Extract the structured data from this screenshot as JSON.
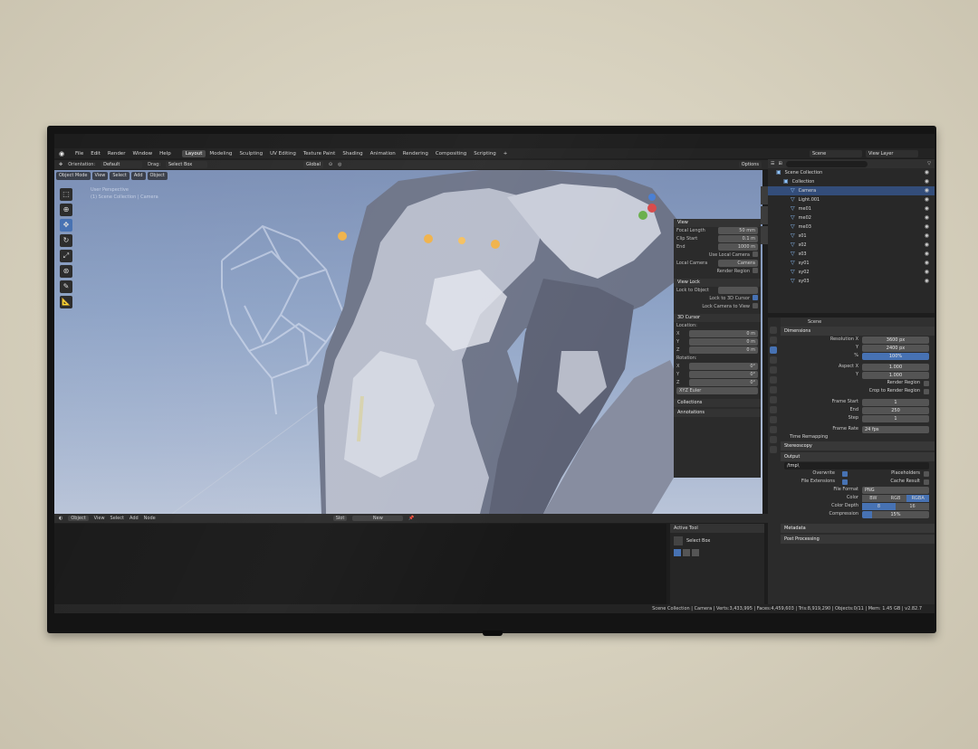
{
  "menu": {
    "items": [
      "File",
      "Edit",
      "Render",
      "Window",
      "Help"
    ],
    "workspaces": [
      "Layout",
      "Modeling",
      "Sculpting",
      "UV Editing",
      "Texture Paint",
      "Shading",
      "Animation",
      "Rendering",
      "Compositing",
      "Scripting"
    ],
    "add_tab": "+",
    "scene": "Scene",
    "view_layer": "View Layer"
  },
  "header": {
    "orientation_label": "Orientation:",
    "orientation_value": "Default",
    "drag_label": "Drag:",
    "drag_value": "Select Box",
    "transform_value": "Global",
    "options": "Options"
  },
  "viewport": {
    "mode": "Object Mode",
    "menu": [
      "View",
      "Select",
      "Add",
      "Object"
    ],
    "info_line1": "User Perspective",
    "info_line2": "(1) Scene Collection | Camera"
  },
  "npanel": {
    "view_header": "View",
    "focal_length_label": "Focal Length",
    "focal_length": "50 mm",
    "clip_start_label": "Clip Start",
    "clip_start": "0.1 m",
    "clip_end_label": "End",
    "clip_end": "1000 m",
    "use_local_camera": "Use Local Camera",
    "local_camera_label": "Local Camera",
    "local_camera_value": "Camera",
    "render_region": "Render Region",
    "view_lock_header": "View Lock",
    "lock_to_object": "Lock to Object",
    "lock_to_3d_cursor": "Lock to 3D Cursor",
    "lock_camera_to_view": "Lock Camera to View",
    "cursor_header": "3D Cursor",
    "location_label": "Location:",
    "x_label": "X",
    "y_label": "Y",
    "z_label": "Z",
    "loc_x": "0 m",
    "loc_y": "0 m",
    "loc_z": "0 m",
    "rotation_label": "Rotation:",
    "rot_x": "0°",
    "rot_y": "0°",
    "rot_z": "0°",
    "rotation_mode": "XYZ Euler",
    "collections": "Collections",
    "annotations": "Annotations"
  },
  "timeline": {
    "editor": "Object",
    "menu": [
      "View",
      "Select",
      "Add",
      "Node"
    ],
    "slot": "Slot",
    "new": "New"
  },
  "active_tool": {
    "header": "Active Tool",
    "tool": "Select Box"
  },
  "outliner": {
    "search_placeholder": "",
    "items": [
      {
        "label": "Scene Collection",
        "indent": 0
      },
      {
        "label": "Collection",
        "indent": 1
      },
      {
        "label": "Camera",
        "indent": 2
      },
      {
        "label": "Light.001",
        "indent": 2
      },
      {
        "label": "me01",
        "indent": 2
      },
      {
        "label": "me02",
        "indent": 2
      },
      {
        "label": "me03",
        "indent": 2
      },
      {
        "label": "s01",
        "indent": 2
      },
      {
        "label": "s02",
        "indent": 2
      },
      {
        "label": "s03",
        "indent": 2
      },
      {
        "label": "sy01",
        "indent": 2
      },
      {
        "label": "sy02",
        "indent": 2
      },
      {
        "label": "sy03",
        "indent": 2
      }
    ]
  },
  "properties": {
    "scene_name": "Scene",
    "dimensions_header": "Dimensions",
    "resolution_x_label": "Resolution X",
    "resolution_x": "3600 px",
    "y_label": "Y",
    "resolution_y": "2400 px",
    "percent_label": "%",
    "percent": "100%",
    "aspect_x_label": "Aspect X",
    "aspect_x": "1.000",
    "aspect_y": "1.000",
    "render_region": "Render Region",
    "crop": "Crop to Render Region",
    "frame_start_label": "Frame Start",
    "frame_start": "1",
    "end_label": "End",
    "frame_end": "250",
    "step_label": "Step",
    "frame_step": "1",
    "frame_rate_label": "Frame Rate",
    "frame_rate": "24 fps",
    "time_remapping": "Time Remapping",
    "stereoscopy": "Stereoscopy",
    "output_header": "Output",
    "output_path": "/tmp\\",
    "overwrite": "Overwrite",
    "placeholders": "Placeholders",
    "file_extensions": "File Extensions",
    "cache_result": "Cache Result",
    "file_format_label": "File Format",
    "file_format": "PNG",
    "color_label": "Color",
    "color_modes": [
      "BW",
      "RGB",
      "RGBA"
    ],
    "color_depth_label": "Color Depth",
    "color_depths": [
      "8",
      "16"
    ],
    "compression_label": "Compression",
    "compression": "15%",
    "metadata": "Metadata",
    "post_processing": "Post Processing"
  },
  "statusbar": {
    "text": "Scene Collection | Camera | Verts:3,433,995 | Faces:4,459,603 | Tris:8,919,290 | Objects:0/11 | Mem: 1.45 GB | v2.82.7"
  },
  "colors": {
    "accent": "#4772b3",
    "viewport_sky": "#8ea3c6",
    "panel": "#2b2b2b"
  }
}
